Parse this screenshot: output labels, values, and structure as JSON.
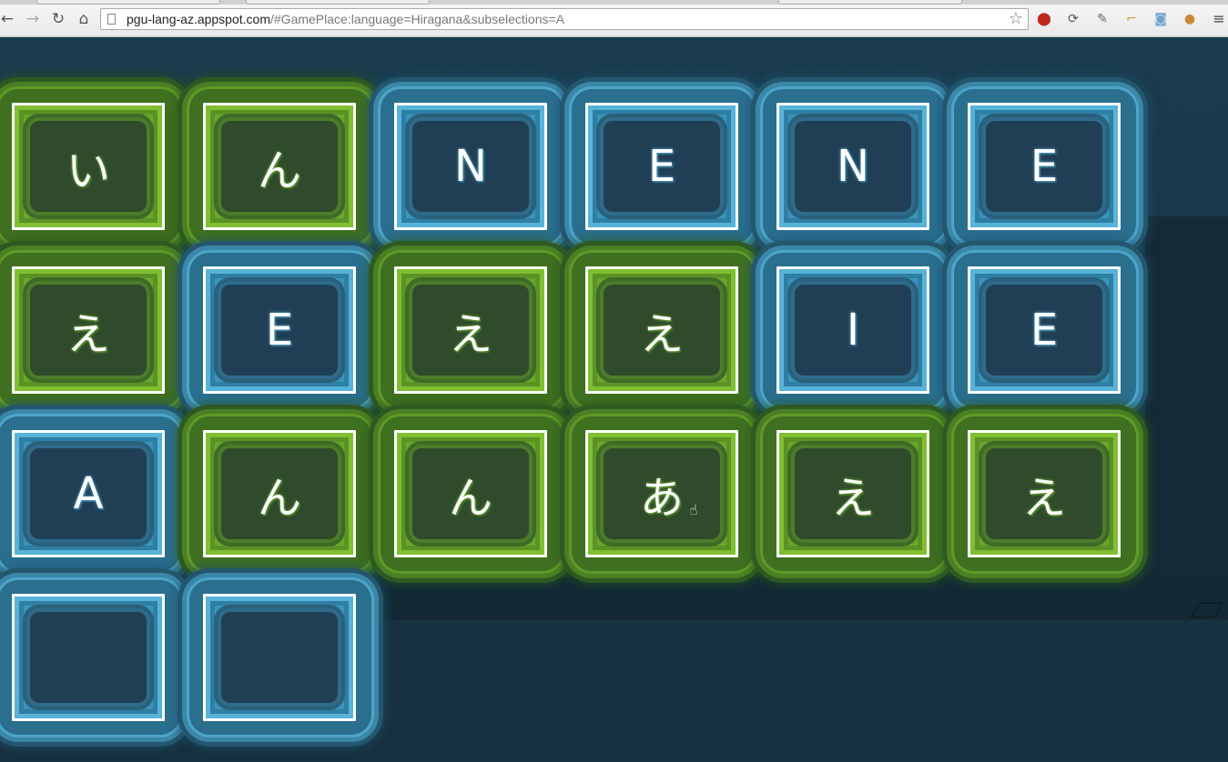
{
  "browser": {
    "url_host": "pgu-lang-az.appspot.com",
    "url_path": "/#GamePlace:language=Hiragana&subselections=A",
    "back_icon": "arrow-left",
    "forward_icon": "arrow-right",
    "reload_icon": "reload",
    "home_icon": "home",
    "bookmark_icon": "star",
    "extension_icons": [
      "adblock-icon",
      "sync-icon",
      "eyedropper-icon",
      "ruler-icon",
      "camera-icon",
      "cookie-icon"
    ],
    "menu_icon": "hamburger-menu"
  },
  "colors": {
    "matched_green": "#6aa82a",
    "unmatched_blue": "#3a94bd",
    "background": "#16313f"
  },
  "board": {
    "rows": [
      [
        {
          "label": "い",
          "state": "green"
        },
        {
          "label": "ん",
          "state": "green"
        },
        {
          "label": "N",
          "state": "blue"
        },
        {
          "label": "E",
          "state": "blue"
        },
        {
          "label": "N",
          "state": "blue"
        },
        {
          "label": "E",
          "state": "blue"
        }
      ],
      [
        {
          "label": "え",
          "state": "green"
        },
        {
          "label": "E",
          "state": "blue"
        },
        {
          "label": "え",
          "state": "green"
        },
        {
          "label": "え",
          "state": "green"
        },
        {
          "label": "I",
          "state": "blue"
        },
        {
          "label": "E",
          "state": "blue"
        }
      ],
      [
        {
          "label": "A",
          "state": "blue"
        },
        {
          "label": "ん",
          "state": "green"
        },
        {
          "label": "ん",
          "state": "green"
        },
        {
          "label": "あ",
          "state": "green"
        },
        {
          "label": "え",
          "state": "green"
        },
        {
          "label": "え",
          "state": "green"
        }
      ],
      [
        {
          "label": "",
          "state": "blue"
        },
        {
          "label": "",
          "state": "blue"
        }
      ]
    ]
  }
}
